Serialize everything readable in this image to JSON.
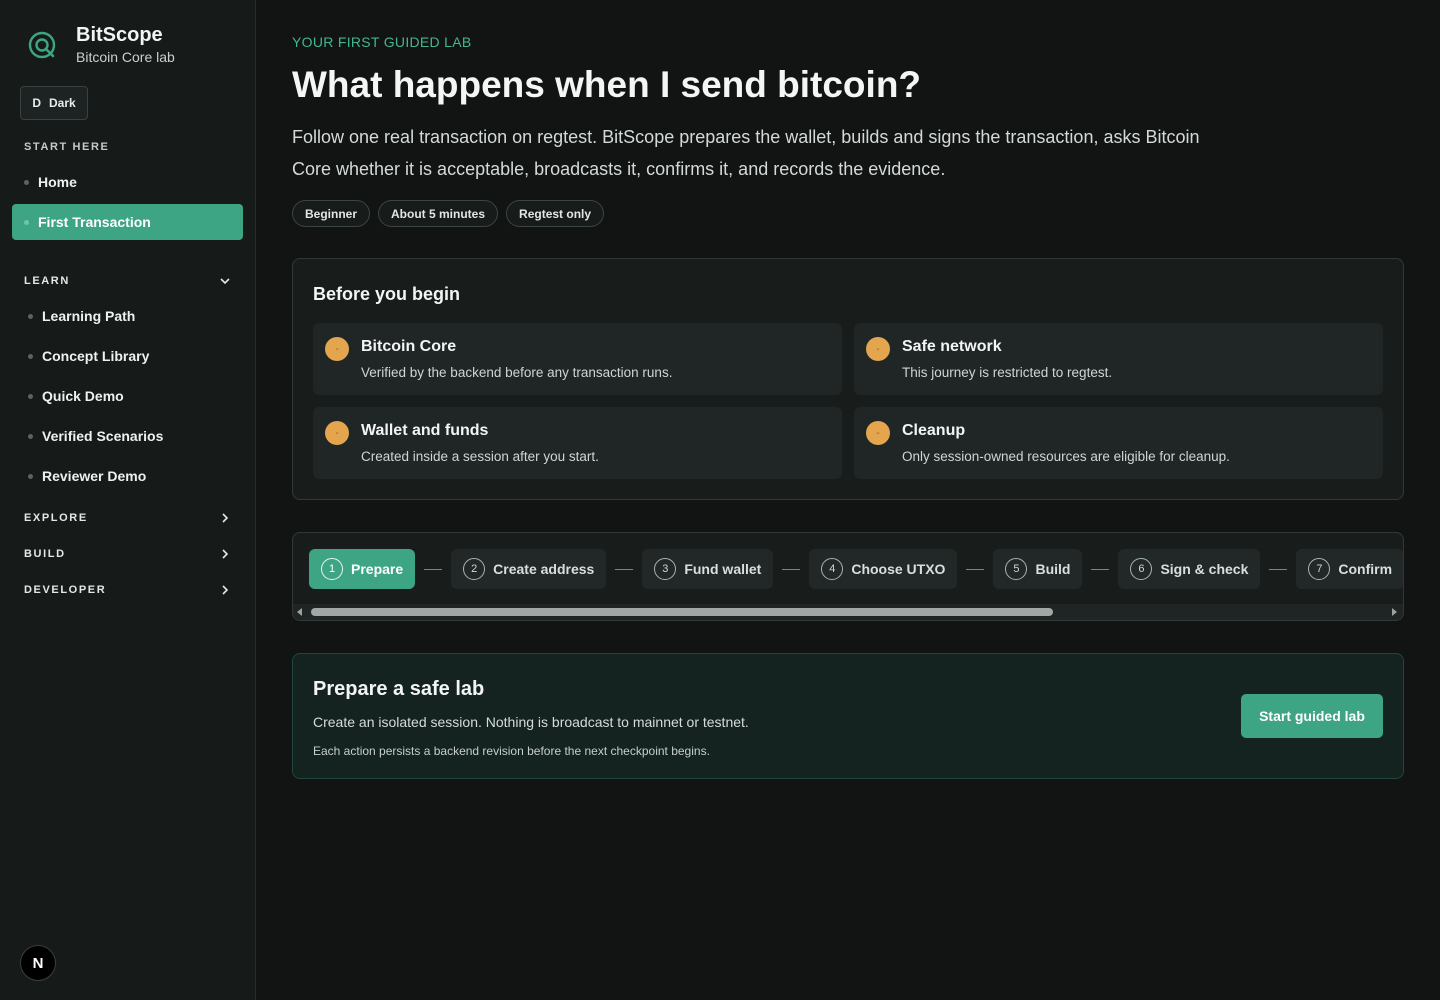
{
  "brand": {
    "title": "BitScope",
    "subtitle": "Bitcoin Core lab"
  },
  "theme_toggle": {
    "icon_letter": "D",
    "label": "Dark"
  },
  "sidebar": {
    "start_here_label": "START HERE",
    "start_items": [
      {
        "label": "Home"
      },
      {
        "label": "First Transaction",
        "active": true
      }
    ],
    "learn_label": "LEARN",
    "learn_items": [
      {
        "label": "Learning Path"
      },
      {
        "label": "Concept Library"
      },
      {
        "label": "Quick Demo"
      },
      {
        "label": "Verified Scenarios"
      },
      {
        "label": "Reviewer Demo"
      }
    ],
    "groups": [
      {
        "label": "EXPLORE"
      },
      {
        "label": "BUILD"
      },
      {
        "label": "DEVELOPER"
      }
    ],
    "next_badge": "N"
  },
  "main": {
    "eyebrow": "YOUR FIRST GUIDED LAB",
    "title": "What happens when I send bitcoin?",
    "intro": "Follow one real transaction on regtest. BitScope prepares the wallet, builds and signs the transaction, asks Bitcoin Core whether it is acceptable, broadcasts it, confirms it, and records the evidence.",
    "chips": [
      "Beginner",
      "About 5 minutes",
      "Regtest only"
    ],
    "before": {
      "title": "Before you begin",
      "items": [
        {
          "title": "Bitcoin Core",
          "desc": "Verified by the backend before any transaction runs.",
          "icon": "-"
        },
        {
          "title": "Safe network",
          "desc": "This journey is restricted to regtest.",
          "icon": "-"
        },
        {
          "title": "Wallet and funds",
          "desc": "Created inside a session after you start.",
          "icon": "-"
        },
        {
          "title": "Cleanup",
          "desc": "Only session-owned resources are eligible for cleanup.",
          "icon": "-"
        }
      ]
    },
    "steps": [
      {
        "num": "1",
        "label": "Prepare",
        "active": true
      },
      {
        "num": "2",
        "label": "Create address"
      },
      {
        "num": "3",
        "label": "Fund wallet"
      },
      {
        "num": "4",
        "label": "Choose UTXO"
      },
      {
        "num": "5",
        "label": "Build"
      },
      {
        "num": "6",
        "label": "Sign & check"
      },
      {
        "num": "7",
        "label": "Confirm"
      }
    ],
    "action": {
      "title": "Prepare a safe lab",
      "desc": "Create an isolated session. Nothing is broadcast to mainnet or testnet.",
      "note": "Each action persists a backend revision before the next checkpoint begins.",
      "button": "Start guided lab"
    }
  },
  "colors": {
    "accent": "#3ea584",
    "warning": "#e3a54e",
    "background": "#111413",
    "sidebar": "#161a19"
  }
}
